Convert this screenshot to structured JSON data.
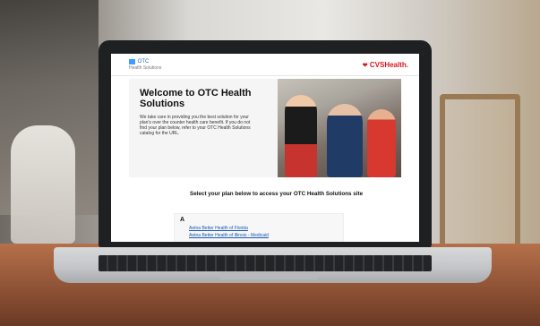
{
  "header": {
    "otc_logo_main": "OTC",
    "otc_logo_sub": "Health Solutions",
    "cvs_logo": "CVSHealth."
  },
  "hero": {
    "title": "Welcome to OTC Health Solutions",
    "body": "We take care in providing you the best solution for your plan's over the counter health care benefit. If you do not find your plan below, refer to your OTC Health Solutions catalog for the URL."
  },
  "plan_selection": {
    "heading": "Select your plan below to access your OTC Health Solutions site",
    "section_letter": "A",
    "plans": [
      "Aetna Better Health of Florida",
      "Aetna Better Health of Illinois - Medicaid"
    ]
  },
  "colors": {
    "cvs_red": "#d71920",
    "link_blue": "#1a56b5",
    "otc_blue": "#3aa0ff"
  }
}
